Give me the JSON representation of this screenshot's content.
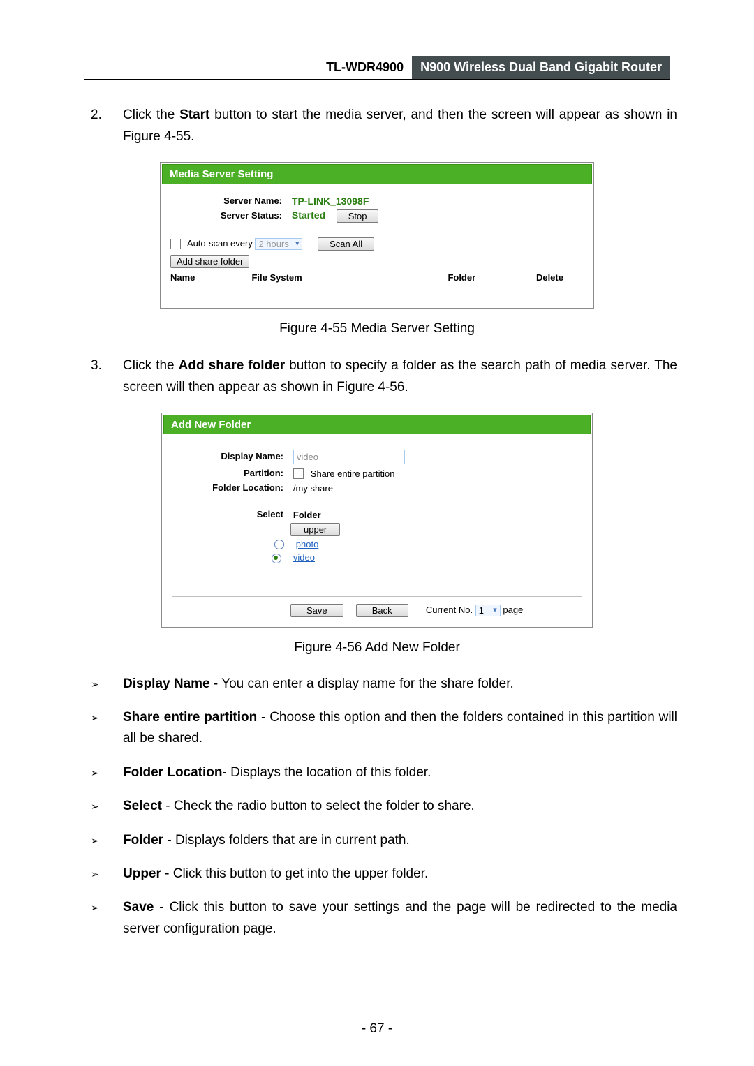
{
  "header": {
    "model": "TL-WDR4900",
    "product": "N900 Wireless Dual Band Gigabit Router"
  },
  "step2": {
    "num": "2.",
    "pre": "Click the ",
    "bold": "Start",
    "post": " button to start the media server, and then the screen will appear as shown in Figure 4-55."
  },
  "shot1": {
    "title": "Media Server Setting",
    "serverNameLabel": "Server Name:",
    "serverName": "TP-LINK_13098F",
    "serverStatusLabel": "Server Status:",
    "serverStatus": "Started",
    "stopBtn": "Stop",
    "autoScanLabel": "Auto-scan every",
    "autoScanSel": "2 hours",
    "scanAllBtn": "Scan All",
    "addShareBtn": "Add share folder",
    "th1": "Name",
    "th2": "File System",
    "th3": "Folder",
    "th4": "Delete"
  },
  "cap1": "Figure 4-55 Media Server Setting",
  "step3": {
    "num": "3.",
    "pre": "Click the ",
    "bold": "Add share folder",
    "post": " button to specify a folder as the search path of media server. The screen will then appear as shown in Figure 4-56."
  },
  "shot2": {
    "title": "Add New Folder",
    "dispLabel": "Display Name:",
    "dispVal": "video",
    "partLabel": "Partition:",
    "partChk": "Share entire partition",
    "locLabel": "Folder Location:",
    "locVal": "/my share",
    "selectLabel": "Select",
    "folderLabel": "Folder",
    "upperBtn": "upper",
    "photo": "photo",
    "video": "video",
    "saveBtn": "Save",
    "backBtn": "Back",
    "curNo": "Current No.",
    "curSel": "1",
    "pageTxt": "page"
  },
  "cap2": "Figure 4-56 Add New Folder",
  "desc": [
    {
      "b": "Display Name",
      "t": " - You can enter a display name for the share folder."
    },
    {
      "b": "Share entire partition",
      "t": " - Choose this option and then the folders contained in this partition will all be shared."
    },
    {
      "b": "Folder Location",
      "t": "- Displays the location of this folder."
    },
    {
      "b": "Select",
      "t": " - Check the radio button to select the folder to share."
    },
    {
      "b": "Folder",
      "t": " - Displays folders that are in current path."
    },
    {
      "b": "Upper",
      "t": " - Click this button to get into the upper folder."
    },
    {
      "b": "Save",
      "t": " - Click this button to save your settings and the page will be redirected to the media server configuration page."
    }
  ],
  "pagenum": "- 67 -"
}
